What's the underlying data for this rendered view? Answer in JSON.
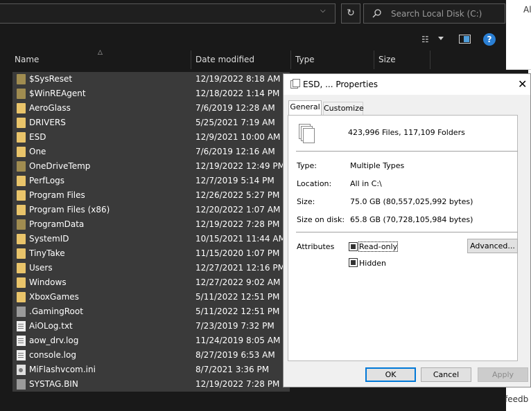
{
  "explorer": {
    "search_placeholder": "Search Local Disk (C:)",
    "columns": [
      "Name",
      "Date modified",
      "Type",
      "Size"
    ],
    "files": [
      {
        "name": "$SysReset",
        "date": "12/19/2022 8:18 AM",
        "kind": "folder-dim"
      },
      {
        "name": "$WinREAgent",
        "date": "12/18/2022 1:14 PM",
        "kind": "folder-dim"
      },
      {
        "name": "AeroGlass",
        "date": "7/6/2019 12:28 AM",
        "kind": "folder"
      },
      {
        "name": "DRIVERS",
        "date": "5/25/2021 7:19 AM",
        "kind": "folder"
      },
      {
        "name": "ESD",
        "date": "12/9/2021 10:00 AM",
        "kind": "folder"
      },
      {
        "name": "One",
        "date": "7/6/2019 12:16 AM",
        "kind": "folder"
      },
      {
        "name": "OneDriveTemp",
        "date": "12/19/2022 12:49 PM",
        "kind": "folder-dim"
      },
      {
        "name": "PerfLogs",
        "date": "12/7/2019 5:14 PM",
        "kind": "folder"
      },
      {
        "name": "Program Files",
        "date": "12/26/2022 5:27 PM",
        "kind": "folder"
      },
      {
        "name": "Program Files (x86)",
        "date": "12/20/2022 1:07 AM",
        "kind": "folder"
      },
      {
        "name": "ProgramData",
        "date": "12/19/2022 7:28 PM",
        "kind": "folder-dim"
      },
      {
        "name": "SystemID",
        "date": "10/15/2021 11:44 AM",
        "kind": "folder"
      },
      {
        "name": "TinyTake",
        "date": "11/15/2020 1:07 PM",
        "kind": "folder"
      },
      {
        "name": "Users",
        "date": "12/27/2021 12:16 PM",
        "kind": "folder"
      },
      {
        "name": "Windows",
        "date": "12/27/2022 9:02 AM",
        "kind": "folder"
      },
      {
        "name": "XboxGames",
        "date": "5/11/2022 12:51 PM",
        "kind": "folder"
      },
      {
        "name": ".GamingRoot",
        "date": "5/11/2022 12:51 PM",
        "kind": "file-gray"
      },
      {
        "name": "AiOLog.txt",
        "date": "7/23/2019 7:32 PM",
        "kind": "file-doc"
      },
      {
        "name": "aow_drv.log",
        "date": "11/24/2019 8:05 AM",
        "kind": "file-doc"
      },
      {
        "name": "console.log",
        "date": "8/27/2019 6:53 AM",
        "kind": "file-doc"
      },
      {
        "name": "MiFlashvcom.ini",
        "date": "8/7/2021 3:36 PM",
        "kind": "file-ini"
      },
      {
        "name": "SYSTAG.BIN",
        "date": "12/19/2022 7:28 PM",
        "kind": "file-gray"
      }
    ]
  },
  "right_edge": {
    "top_text": "Al",
    "bottom_text": "feedb"
  },
  "dialog": {
    "title": "ESD, ... Properties",
    "tabs": [
      "General",
      "Customize"
    ],
    "summary": "423,996 Files, 117,109 Folders",
    "type_label": "Type:",
    "type_value": "Multiple Types",
    "location_label": "Location:",
    "location_value": "All in C:\\",
    "size_label": "Size:",
    "size_value": "75.0 GB (80,557,025,992 bytes)",
    "size_on_disk_label": "Size on disk:",
    "size_on_disk_value": "65.8 GB (70,728,105,984 bytes)",
    "attributes_label": "Attributes",
    "readonly_label": "Read-only",
    "hidden_label": "Hidden",
    "advanced_label": "Advanced...",
    "ok_label": "OK",
    "cancel_label": "Cancel",
    "apply_label": "Apply"
  }
}
